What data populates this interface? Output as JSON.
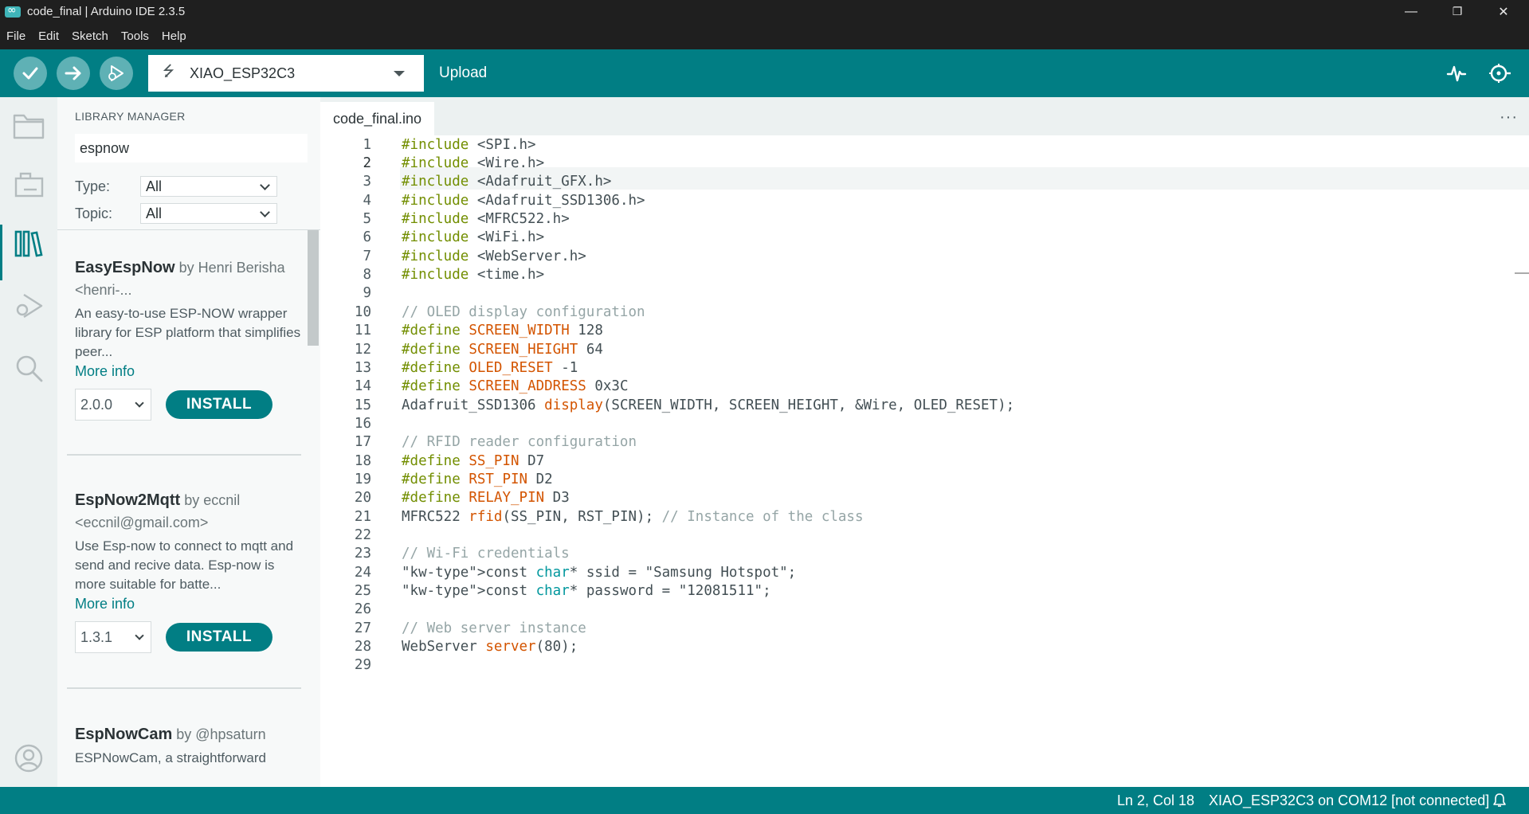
{
  "window": {
    "title": "code_final | Arduino IDE 2.3.5",
    "minimize": "—",
    "restore": "❐",
    "close": "✕"
  },
  "menu": [
    "File",
    "Edit",
    "Sketch",
    "Tools",
    "Help"
  ],
  "toolbar": {
    "board": "XIAO_ESP32C3",
    "hover_label": "Upload"
  },
  "library_manager": {
    "header": "LIBRARY MANAGER",
    "search_value": "espnow",
    "type_label": "Type:",
    "type_value": "All",
    "topic_label": "Topic:",
    "topic_value": "All",
    "items": [
      {
        "name": "EasyEspNow",
        "by": " by Henri Berisha <henri-...",
        "description": "An easy-to-use ESP-NOW wrapper library for ESP platform that simplifies peer...",
        "more": "More info",
        "version": "2.0.0",
        "install": "INSTALL"
      },
      {
        "name": "EspNow2Mqtt",
        "by": " by eccnil <eccnil@gmail.com>",
        "description": "Use Esp-now to connect to mqtt and send and recive data. Esp-now is more suitable for batte...",
        "more": "More info",
        "version": "1.3.1",
        "install": "INSTALL"
      },
      {
        "name": "EspNowCam",
        "by": " by @hpsaturn",
        "description": "ESPNowCam, a straightforward"
      }
    ]
  },
  "editor": {
    "tab": "code_final.ino",
    "more": "···",
    "lines": [
      {
        "n": "1",
        "t": "#include <SPI.h>"
      },
      {
        "n": "2",
        "t": "#include <Wire.h>"
      },
      {
        "n": "3",
        "t": "#include <Adafruit_GFX.h>"
      },
      {
        "n": "4",
        "t": "#include <Adafruit_SSD1306.h>"
      },
      {
        "n": "5",
        "t": "#include <MFRC522.h>"
      },
      {
        "n": "6",
        "t": "#include <WiFi.h>"
      },
      {
        "n": "7",
        "t": "#include <WebServer.h>"
      },
      {
        "n": "8",
        "t": "#include <time.h>"
      },
      {
        "n": "9",
        "t": ""
      },
      {
        "n": "10",
        "t": "// OLED display configuration"
      },
      {
        "n": "11",
        "t": "#define SCREEN_WIDTH 128"
      },
      {
        "n": "12",
        "t": "#define SCREEN_HEIGHT 64"
      },
      {
        "n": "13",
        "t": "#define OLED_RESET -1"
      },
      {
        "n": "14",
        "t": "#define SCREEN_ADDRESS 0x3C"
      },
      {
        "n": "15",
        "t": "Adafruit_SSD1306 display(SCREEN_WIDTH, SCREEN_HEIGHT, &Wire, OLED_RESET);"
      },
      {
        "n": "16",
        "t": ""
      },
      {
        "n": "17",
        "t": "// RFID reader configuration"
      },
      {
        "n": "18",
        "t": "#define SS_PIN D7"
      },
      {
        "n": "19",
        "t": "#define RST_PIN D2"
      },
      {
        "n": "20",
        "t": "#define RELAY_PIN D3"
      },
      {
        "n": "21",
        "t": "MFRC522 rfid(SS_PIN, RST_PIN); // Instance of the class"
      },
      {
        "n": "22",
        "t": ""
      },
      {
        "n": "23",
        "t": "// Wi-Fi credentials"
      },
      {
        "n": "24",
        "t": "const char* ssid = \"Samsung Hotspot\";"
      },
      {
        "n": "25",
        "t": "const char* password = \"12081511\";"
      },
      {
        "n": "26",
        "t": ""
      },
      {
        "n": "27",
        "t": "// Web server instance"
      },
      {
        "n": "28",
        "t": "WebServer server(80);"
      },
      {
        "n": "29",
        "t": ""
      }
    ]
  },
  "status": {
    "position": "Ln 2, Col 18",
    "board": "XIAO_ESP32C3 on COM12 [not connected]"
  },
  "colors": {
    "accent": "#017e84",
    "preprocessor": "#728e00",
    "type": "#00979d",
    "macro": "#d35400",
    "comment": "#95a5a6",
    "string": "#005c5f"
  }
}
